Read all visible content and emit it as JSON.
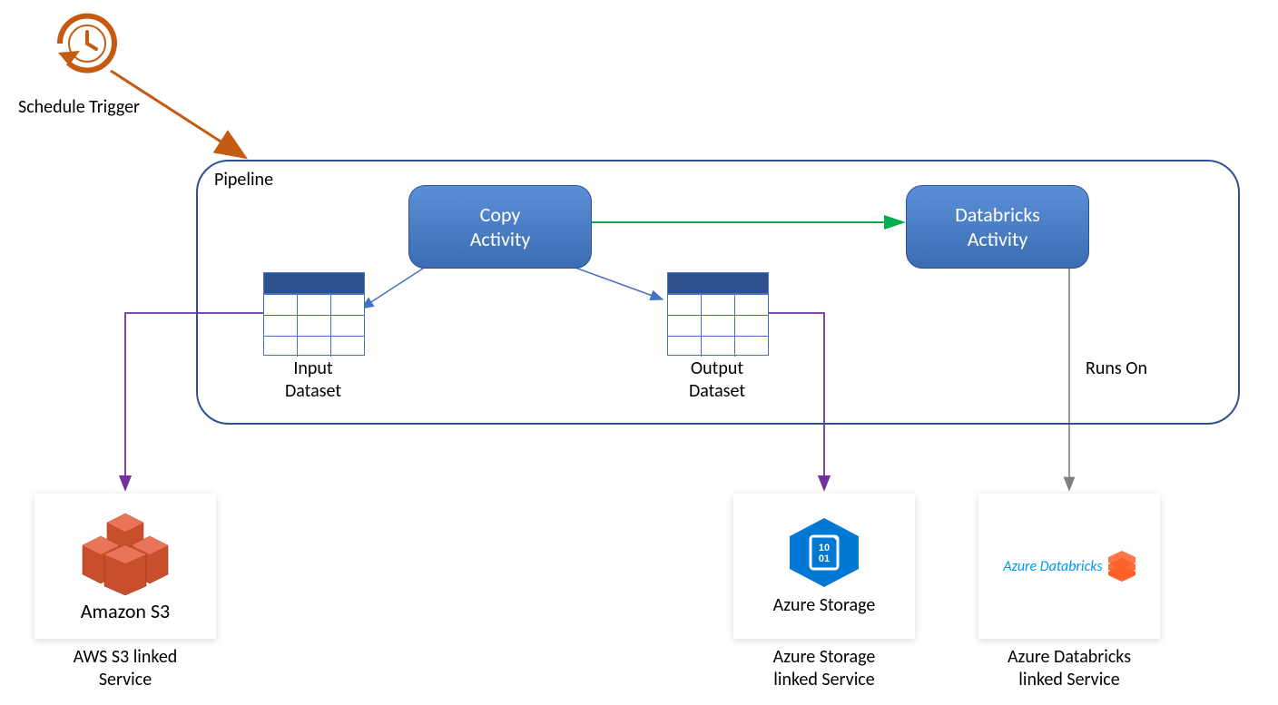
{
  "trigger": {
    "label": "Schedule Trigger"
  },
  "pipeline": {
    "title": "Pipeline",
    "copy_activity_line1": "Copy",
    "copy_activity_line2": "Activity",
    "databricks_activity_line1": "Databricks",
    "databricks_activity_line2": "Activity",
    "input_dataset_line1": "Input",
    "input_dataset_line2": "Dataset",
    "output_dataset_line1": "Output",
    "output_dataset_line2": "Dataset",
    "runs_on_label": "Runs On"
  },
  "services": {
    "s3_logo_text": "Amazon S3",
    "s3_label_line1": "AWS S3 linked",
    "s3_label_line2": "Service",
    "azstorage_logo_text": "Azure Storage",
    "azstorage_label_line1": "Azure Storage",
    "azstorage_label_line2": "linked Service",
    "azdatabricks_logo_text": "Azure Databricks",
    "azdatabricks_label_line1": "Azure Databricks",
    "azdatabricks_label_line2": "linked Service"
  },
  "colors": {
    "trigger": "#C55A11",
    "pipeline_border": "#2F528F",
    "activity_fill": "#4472C4",
    "success_arrow": "#00B050",
    "link_arrow_blue": "#4472C4",
    "link_arrow_purple": "#7030A0",
    "link_arrow_grey": "#808080",
    "s3_orange": "#C94E2C",
    "azure_blue": "#0078D4"
  }
}
